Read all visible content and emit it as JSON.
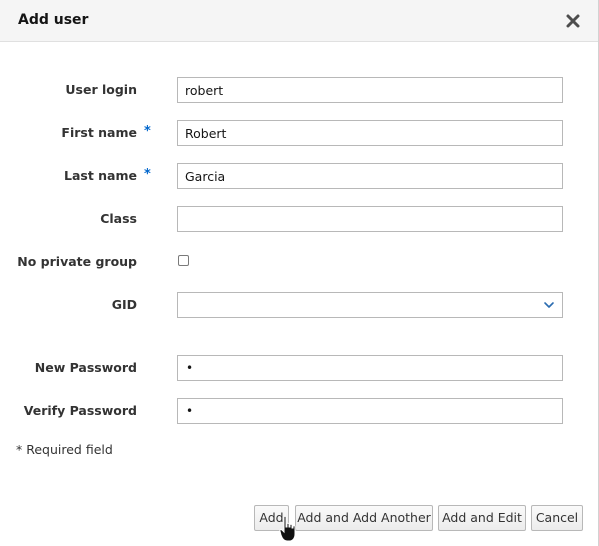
{
  "dialog": {
    "title": "Add user",
    "close_icon": "close-icon"
  },
  "fields": {
    "user_login": {
      "label": "User login",
      "value": "robert"
    },
    "first_name": {
      "label": "First name",
      "value": "Robert",
      "required_mark": "*"
    },
    "last_name": {
      "label": "Last name",
      "value": "Garcia",
      "required_mark": "*"
    },
    "class": {
      "label": "Class",
      "value": ""
    },
    "no_private_group": {
      "label": "No private group",
      "checked": false
    },
    "gid": {
      "label": "GID",
      "value": "",
      "icon": "chevron-down-icon"
    },
    "new_password": {
      "label": "New Password",
      "masked_value": "•"
    },
    "verify_password": {
      "label": "Verify Password",
      "masked_value": "•"
    }
  },
  "required_note": "* Required field",
  "buttons": {
    "add": "Add",
    "add_another": "Add and Add Another",
    "add_edit": "Add and Edit",
    "cancel": "Cancel"
  },
  "colors": {
    "required_accent": "#0066cc",
    "header_bg": "#f5f5f5"
  }
}
